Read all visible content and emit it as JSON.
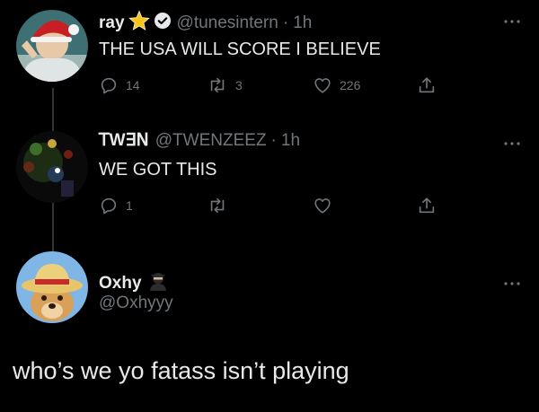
{
  "tweets": [
    {
      "name": "ray",
      "handle": "@tunesintern",
      "dot": "·",
      "time": "1h",
      "text": "THE USA WILL SCORE I BELIEVE",
      "replies": "14",
      "retweets": "3",
      "likes": "226"
    },
    {
      "name": "ꓔW∃ꓠ",
      "handle": "@TWENZEEZ",
      "dot": "·",
      "time": "1h",
      "text": "WE GOT THIS",
      "replies": "1",
      "retweets": "",
      "likes": ""
    }
  ],
  "reply": {
    "name": "Oxhy",
    "handle": "@Oxhyyy",
    "text": "who’s we yo fatass isn’t playing"
  },
  "colors": {
    "background": "#000000",
    "text": "#e7e9ea",
    "muted": "#71767b",
    "verified": "#1d9bf0",
    "star": "#f5c518"
  }
}
